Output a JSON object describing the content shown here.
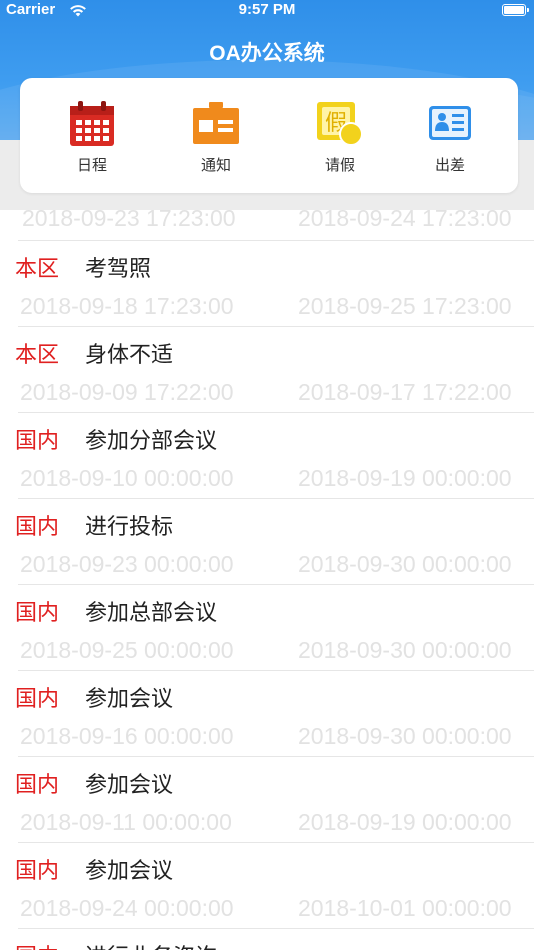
{
  "status_bar": {
    "carrier": "Carrier",
    "time": "9:57 PM"
  },
  "header": {
    "title": "OA办公系统"
  },
  "menu": [
    {
      "label": "日程",
      "icon": "calendar-icon",
      "color": "#d92b23"
    },
    {
      "label": "通知",
      "icon": "notice-icon",
      "color": "#f08a1c"
    },
    {
      "label": "请假",
      "icon": "leave-icon",
      "color": "#f2d21c"
    },
    {
      "label": "出差",
      "icon": "business-trip-icon",
      "color": "#2f8fe9"
    }
  ],
  "first_dates": {
    "start": "2018-09-23 17:23:00",
    "end": "2018-09-24 17:23:00"
  },
  "items": [
    {
      "tag": "本区",
      "title": "考驾照",
      "start": "2018-09-18 17:23:00",
      "end": "2018-09-25 17:23:00"
    },
    {
      "tag": "本区",
      "title": "身体不适",
      "start": "2018-09-09 17:22:00",
      "end": "2018-09-17 17:22:00"
    },
    {
      "tag": "国内",
      "title": "参加分部会议",
      "start": "2018-09-10 00:00:00",
      "end": "2018-09-19 00:00:00"
    },
    {
      "tag": "国内",
      "title": "进行投标",
      "start": "2018-09-23 00:00:00",
      "end": "2018-09-30 00:00:00"
    },
    {
      "tag": "国内",
      "title": "参加总部会议",
      "start": "2018-09-25 00:00:00",
      "end": "2018-09-30 00:00:00"
    },
    {
      "tag": "国内",
      "title": "参加会议",
      "start": "2018-09-16 00:00:00",
      "end": "2018-09-30 00:00:00"
    },
    {
      "tag": "国内",
      "title": "参加会议",
      "start": "2018-09-11 00:00:00",
      "end": "2018-09-19 00:00:00"
    },
    {
      "tag": "国内",
      "title": "参加会议",
      "start": "2018-09-24 00:00:00",
      "end": "2018-10-01 00:00:00"
    },
    {
      "tag": "国内",
      "title": "进行业务咨询",
      "start": "",
      "end": ""
    }
  ]
}
